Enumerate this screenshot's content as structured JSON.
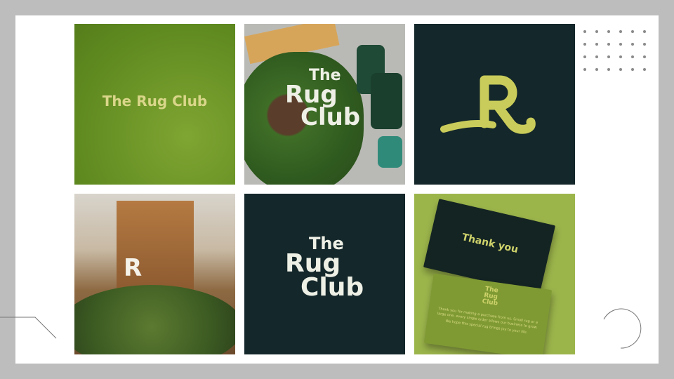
{
  "tiles": {
    "logo_horizontal": {
      "text": "The Rug Club"
    },
    "moss_rug": {
      "line1": "The",
      "line2": "Rug",
      "line3": "Club"
    },
    "monogram": {
      "letter": "R"
    },
    "interior": {
      "letter": "R"
    },
    "logo_stacked": {
      "line1": "The",
      "line2": "Rug",
      "line3": "Club"
    },
    "cards": {
      "thank_you": "Thank you",
      "logo_line1": "The",
      "logo_line2": "Rug",
      "logo_line3": "Club",
      "message1": "Thank you for making a purchase from us. Small rug or a large one, every single order allows our business to grow.",
      "message2": "We hope this special rug brings joy to your life."
    }
  },
  "colors": {
    "background": "#bdbdbd",
    "panel": "#ffffff",
    "dark_green": "#14272a",
    "lime": "#d9d68a",
    "olive": "#6b9426"
  }
}
